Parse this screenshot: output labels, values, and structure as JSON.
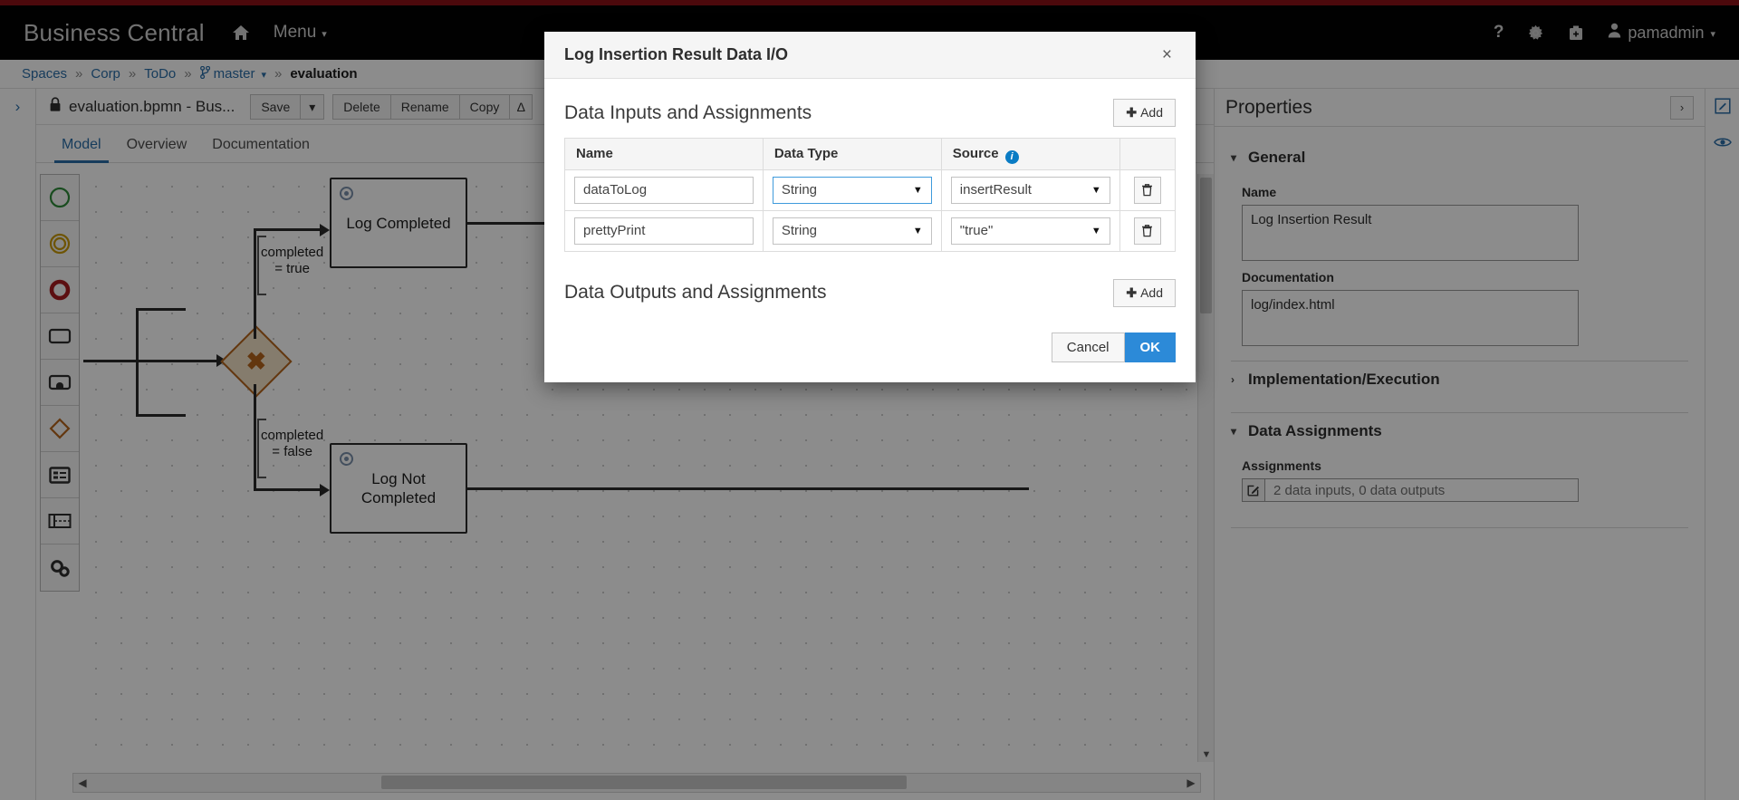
{
  "masthead": {
    "brand": "Business Central",
    "home_icon": "home-icon",
    "menu_label": "Menu",
    "help_icon": "question-mark-icon",
    "settings_icon": "gear-icon",
    "kit_icon": "briefcase-icon",
    "user_icon": "user-icon",
    "user_name": "pamadmin"
  },
  "breadcrumb": {
    "items": [
      {
        "label": "Spaces",
        "type": "link"
      },
      {
        "label": "Corp",
        "type": "link"
      },
      {
        "label": "ToDo",
        "type": "link"
      },
      {
        "label": "master",
        "type": "branch"
      },
      {
        "label": "evaluation",
        "type": "current"
      }
    ],
    "separator": "»",
    "branch_icon": "git-branch-icon"
  },
  "editor": {
    "collapse_icon": "chevron-right-icon",
    "lock_icon": "lock-icon",
    "file_name": "evaluation.bpmn - Bus...",
    "toolbar_buttons": [
      "Save",
      "Delete",
      "Rename",
      "Copy"
    ],
    "save_caret_icon": "chevron-down-icon",
    "partial_button": "Δ",
    "tabs": [
      {
        "label": "Model",
        "active": true
      },
      {
        "label": "Overview",
        "active": false
      },
      {
        "label": "Documentation",
        "active": false
      }
    ],
    "palette": [
      {
        "name": "start-event-icon",
        "shape": "circle-green"
      },
      {
        "name": "intermediate-event-icon",
        "shape": "double-circle-yellow"
      },
      {
        "name": "end-event-icon",
        "shape": "thick-circle-red"
      },
      {
        "name": "task-icon",
        "shape": "rounded-rect"
      },
      {
        "name": "subprocess-icon",
        "shape": "rect-arch"
      },
      {
        "name": "gateway-icon",
        "shape": "diamond-orange"
      },
      {
        "name": "data-object-icon",
        "shape": "list-box"
      },
      {
        "name": "swimlane-icon",
        "shape": "lane"
      },
      {
        "name": "service-task-icon",
        "shape": "gears"
      }
    ],
    "diagram": {
      "gateway_symbol": "✖",
      "nodes": [
        {
          "label": "Log Completed",
          "badge": "service-task-badge"
        },
        {
          "label": "Log Not Completed",
          "badge": "service-task-badge"
        }
      ],
      "flow_labels": [
        "completed\n= true",
        "completed\n= false"
      ],
      "flow_label_top_line1": "completed",
      "flow_label_top_line2": "= true",
      "flow_label_bottom_line1": "completed",
      "flow_label_bottom_line2": "= false",
      "node_top_label": "Log Completed",
      "node_bottom_label": "Log Not Completed"
    },
    "scroll_left_icon": "◀",
    "scroll_right_icon": "▶",
    "scroll_down_icon": "▼"
  },
  "properties": {
    "title": "Properties",
    "expand_icon": "chevron-right-icon",
    "sections": [
      {
        "label": "General",
        "expanded": true
      },
      {
        "label": "Implementation/Execution",
        "expanded": false
      },
      {
        "label": "Data Assignments",
        "expanded": true
      }
    ],
    "general_label": "General",
    "implementation_label": "Implementation/Execution",
    "data_assignments_label": "Data Assignments",
    "name_label": "Name",
    "name_value": "Log Insertion Result",
    "documentation_label": "Documentation",
    "documentation_value": "log/index.html",
    "assignments_label": "Assignments",
    "assignments_value": "2 data inputs, 0 data outputs",
    "assignments_edit_icon": "pencil-edit-icon",
    "chevron_expanded": "⌄",
    "chevron_collapsed": "›"
  },
  "rail": {
    "edit_icon": "pencil-square-icon",
    "eye_icon": "eye-icon"
  },
  "modal": {
    "title": "Log Insertion Result Data I/O",
    "close_icon": "close-icon",
    "inputs_section_title": "Data Inputs and Assignments",
    "outputs_section_title": "Data Outputs and Assignments",
    "add_label": "Add",
    "add_plus": "✚",
    "columns": [
      "Name",
      "Data Type",
      "Source"
    ],
    "source_info_icon": "info-icon",
    "source_info_glyph": "i",
    "dropdown_arrow": "▼",
    "trash_icon": "trash-icon",
    "trash_glyph": "🗑",
    "rows": [
      {
        "name": "dataToLog",
        "data_type": "String",
        "source": "insertResult",
        "data_type_focused": true
      },
      {
        "name": "prettyPrint",
        "data_type": "String",
        "source": "\"true\"",
        "data_type_focused": false
      }
    ],
    "cancel_label": "Cancel",
    "ok_label": "OK"
  },
  "colors": {
    "accent_blue": "#2b6ea8",
    "ok_blue": "#2c8ad8",
    "brand_red": "#8b1117",
    "gateway_orange": "#b5651d",
    "start_green": "#2e8b3a",
    "end_red": "#a81c20",
    "intermediate_yellow": "#c99a08",
    "info_blue": "#0a7cc4"
  }
}
